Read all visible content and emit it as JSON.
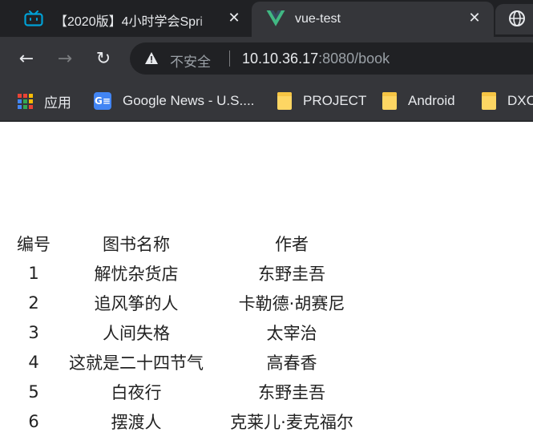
{
  "tabs": [
    {
      "title": "【2020版】4小时学会Spri",
      "favicon": "bilibili-tv-icon",
      "active": false
    },
    {
      "title": "vue-test",
      "favicon": "vue-logo-icon",
      "active": true
    }
  ],
  "tab_extra_icon": "globe-icon",
  "tab_close_glyph": "✕",
  "toolbar": {
    "back_glyph": "←",
    "forward_glyph": "→",
    "reload_glyph": "↻",
    "security_label": "不安全",
    "url_host": "10.10.36.17",
    "url_rest": ":8080/book"
  },
  "bookmarks": [
    {
      "label": "应用",
      "icon": "apps-grid-icon"
    },
    {
      "label": "Google News - U.S....",
      "icon": "google-news-icon"
    },
    {
      "label": "PROJECT",
      "icon": "folder-icon"
    },
    {
      "label": "Android",
      "icon": "folder-icon"
    },
    {
      "label": "DXC",
      "icon": "folder-icon"
    }
  ],
  "book_table": {
    "headers": {
      "id": "编号",
      "title": "图书名称",
      "author": "作者"
    },
    "rows": [
      {
        "id": "1",
        "title": "解忧杂货店",
        "author": "东野圭吾"
      },
      {
        "id": "2",
        "title": "追风筝的人",
        "author": "卡勒德·胡赛尼"
      },
      {
        "id": "3",
        "title": "人间失格",
        "author": "太宰治"
      },
      {
        "id": "4",
        "title": "这就是二十四节气",
        "author": "高春香"
      },
      {
        "id": "5",
        "title": "白夜行",
        "author": "东野圭吾"
      },
      {
        "id": "6",
        "title": "摆渡人",
        "author": "克莱儿·麦克福尔"
      }
    ]
  },
  "colors": {
    "tabstrip_bg": "#202124",
    "toolbar_bg": "#35363a",
    "vue_green": "#41b883",
    "bilibili_blue": "#00a1d6",
    "folder_yellow": "#fdd663"
  }
}
